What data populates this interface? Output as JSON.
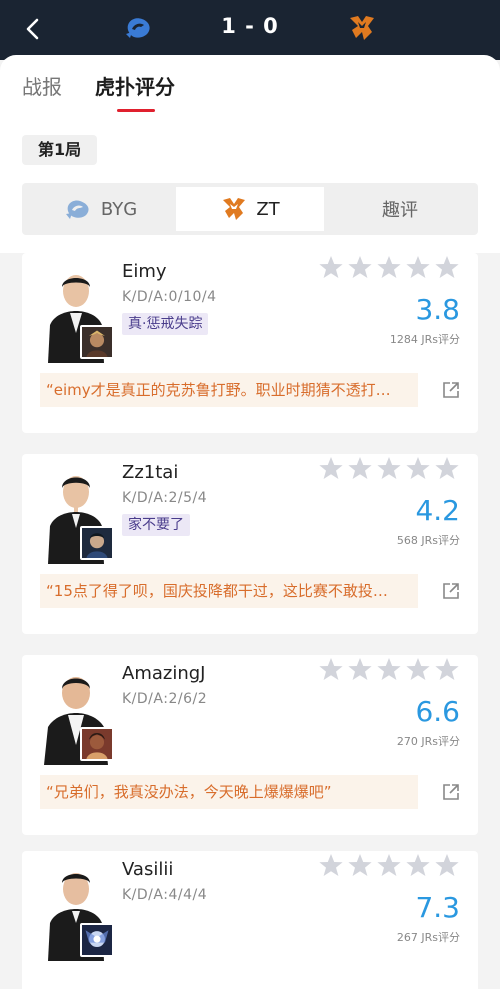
{
  "header": {
    "score": "1 - 0",
    "left_team_logo": "byg-logo",
    "right_team_logo": "zt-logo"
  },
  "tabs": {
    "zhanbao": "战报",
    "hupu": "虎扑评分"
  },
  "game_label": "第1局",
  "segments": {
    "byg": "BYG",
    "zt": "ZT",
    "qp": "趣评"
  },
  "colors": {
    "accent_red": "#e0202e",
    "score_blue": "#2a98e0",
    "comment_orange": "#d86d2c",
    "header_dark": "#1a2432"
  },
  "players": [
    {
      "name": "Eimy",
      "kda": "K/D/A:0/10/4",
      "tag": "真·惩戒失踪",
      "rating": "3.8",
      "rating_count": "1284 JRs评分",
      "comment": "“eimy才是真正的克苏鲁打野。职业时期猜不透打…"
    },
    {
      "name": "Zz1tai",
      "kda": "K/D/A:2/5/4",
      "tag": "家不要了",
      "rating": "4.2",
      "rating_count": "568 JRs评分",
      "comment": "“15点了得了呗，国庆投降都干过，这比赛不敢投…"
    },
    {
      "name": "AmazingJ",
      "kda": "K/D/A:2/6/2",
      "tag": "",
      "rating": "6.6",
      "rating_count": "270 JRs评分",
      "comment": "“兄弟们，我真没办法，今天晚上爆爆爆吧”"
    },
    {
      "name": "Vasilii",
      "kda": "K/D/A:4/4/4",
      "tag": "",
      "rating": "7.3",
      "rating_count": "267 JRs评分",
      "comment": ""
    }
  ]
}
